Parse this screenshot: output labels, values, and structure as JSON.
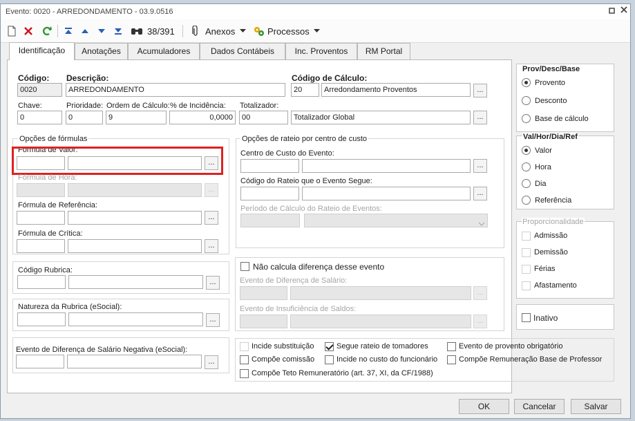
{
  "window": {
    "title": "Evento: 0020 - ARREDONDAMENTO - 03.9.0516",
    "restore_icon": "restore-icon",
    "close_icon": "close-icon"
  },
  "toolbar": {
    "record_position": "38/391",
    "attachments_label": "Anexos",
    "processes_label": "Processos"
  },
  "tabs": [
    {
      "label": "Identificação",
      "active": true
    },
    {
      "label": "Anotações"
    },
    {
      "label": "Acumuladores"
    },
    {
      "label": "Dados Contábeis"
    },
    {
      "label": "Inc. Proventos"
    },
    {
      "label": "RM Portal"
    }
  ],
  "identification": {
    "codigo_label": "Código:",
    "codigo_value": "0020",
    "descricao_label": "Descrição:",
    "descricao_value": "ARREDONDAMENTO",
    "codigo_calculo_label": "Código de Cálculo:",
    "codigo_calculo_value": "20",
    "codigo_calculo_desc": "Arredondamento Proventos",
    "chave_label": "Chave:",
    "chave_value": "0",
    "prioridade_label": "Prioridade:",
    "prioridade_value": "0",
    "ordem_label": "Ordem de Cálculo:",
    "ordem_value": "9",
    "incidencia_label": "% de Incidência:",
    "incidencia_value": "0,0000",
    "totalizador_label": "Totalizador:",
    "totalizador_value": "00",
    "totalizador_desc": "Totalizador Global"
  },
  "formulas": {
    "group_label": "Opções de fórmulas",
    "valor_label": "Fórmula de Valor:",
    "hora_label": "Fórmula de Hora:",
    "referencia_label": "Fórmula de Referência:",
    "critica_label": "Fórmula de Crítica:"
  },
  "rateio": {
    "group_label": "Opções de rateio por centro de custo",
    "centro_label": "Centro de Custo do Evento:",
    "codigo_rateio_label": "Código do Rateio que o Evento Segue:",
    "periodo_label": "Período de Cálculo do Rateio de Eventos:"
  },
  "rubrica": {
    "codigo_label": "Código Rubrica:",
    "natureza_label": "Natureza da Rubrica (eSocial):",
    "evento_dif_label": "Evento de Diferença de Salário Negativa (eSocial):"
  },
  "diferenca": {
    "nao_calcula_label": "Não calcula diferença desse evento",
    "evento_dif_salario_label": "Evento de Diferença de Salário:",
    "evento_insuf_label": "Evento de Insuficiência de Saldos:"
  },
  "checks": {
    "incide_substituicao": "Incide substituição",
    "segue_rateio": "Segue rateio de tomadores",
    "evento_provento": "Evento de provento obrigatório",
    "compoe_comissao": "Compõe comissão",
    "incide_custo": "Incide no custo do funcionário",
    "compoe_remuneracao": "Compõe Remuneração Base de Professor",
    "compoe_teto": "Compõe Teto Remuneratório (art. 37, XI, da CF/1988)"
  },
  "prov_desc_base": {
    "title": "Prov/Desc/Base",
    "options": [
      "Provento",
      "Desconto",
      "Base de cálculo"
    ],
    "selected": "Provento"
  },
  "val_hora_dia_ref": {
    "title": "Val/Hor/Dia/Ref",
    "options": [
      "Valor",
      "Hora",
      "Dia",
      "Referência"
    ],
    "selected": "Valor"
  },
  "proporcionalidade": {
    "title": "Proporcionalidade",
    "options": [
      "Admissão",
      "Demissão",
      "Férias",
      "Afastamento"
    ]
  },
  "inativo_label": "Inativo",
  "buttons": {
    "ok": "OK",
    "cancel": "Cancelar",
    "save": "Salvar"
  },
  "ellipsis": "..."
}
